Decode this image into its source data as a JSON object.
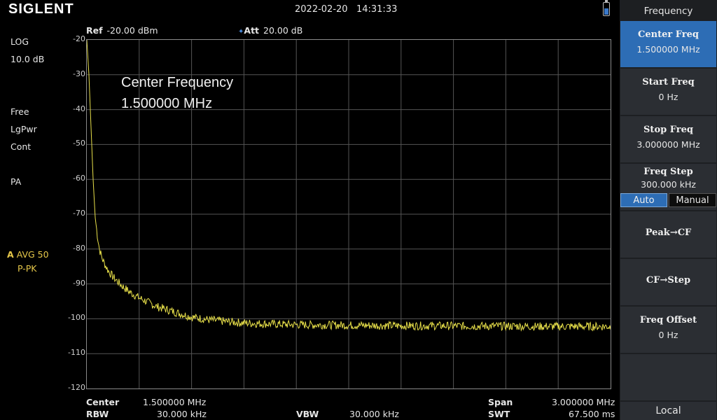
{
  "header": {
    "logo": "SIGLENT",
    "date": "2022-02-20",
    "time": "14:31:33"
  },
  "left_panel": {
    "scale_type": "LOG",
    "scale_div": "10.0 dB",
    "trigger": "Free",
    "detector": "LgPwr",
    "sweep": "Cont",
    "preamp": "PA",
    "trace_label": "A",
    "trace_mode": "AVG 50",
    "trace_detect": "P-PK"
  },
  "top_info": {
    "ref_label": "Ref",
    "ref_value": "-20.00 dBm",
    "att_label": "Att",
    "att_value": "20.00 dB"
  },
  "marker_overlay": {
    "title": "Center Frequency",
    "value": "1.500000 MHz"
  },
  "bottom": {
    "center_label": "Center",
    "center_value": "1.500000 MHz",
    "rbw_label": "RBW",
    "rbw_value": "30.000 kHz",
    "vbw_label": "VBW",
    "vbw_value": "30.000 kHz",
    "span_label": "Span",
    "span_value": "3.000000 MHz",
    "swt_label": "SWT",
    "swt_value": "67.500 ms"
  },
  "sidebar": {
    "title": "Frequency",
    "buttons": [
      {
        "label": "Center Freq",
        "value": "1.500000 MHz"
      },
      {
        "label": "Start Freq",
        "value": "0 Hz"
      },
      {
        "label": "Stop Freq",
        "value": "3.000000 MHz"
      },
      {
        "label": "Freq Step",
        "value": "300.000 kHz"
      },
      {
        "label": "Peak→CF"
      },
      {
        "label": "CF→Step"
      },
      {
        "label": "Freq Offset",
        "value": "0 Hz"
      }
    ],
    "toggle_auto": "Auto",
    "toggle_manual": "Manual",
    "local": "Local"
  },
  "colors": {
    "trace": "#e8e04a",
    "grid": "#555555",
    "active_button": "#2d6db5"
  },
  "chart_data": {
    "type": "line",
    "x_unit": "MHz",
    "y_unit": "dBm",
    "xlim": [
      0,
      3
    ],
    "ylim": [
      -120,
      -20
    ],
    "y_ticks": [
      -20,
      -30,
      -40,
      -50,
      -60,
      -70,
      -80,
      -90,
      -100,
      -110,
      -120
    ],
    "grid": true,
    "series": [
      {
        "x": [
          0,
          0.012,
          0.024,
          0.036,
          0.048,
          0.06,
          0.072,
          0.09,
          0.12,
          0.15,
          0.2,
          0.25,
          0.3,
          0.4,
          0.5,
          0.6,
          0.7,
          0.8,
          0.9,
          1.0,
          1.2,
          1.4,
          1.6,
          1.8,
          2.0,
          2.2,
          2.4,
          2.6,
          2.8,
          3.0
        ],
        "y": [
          -20,
          -30,
          -45,
          -60,
          -71,
          -76,
          -80,
          -83,
          -86,
          -88,
          -90.5,
          -92.5,
          -94,
          -96.5,
          -98,
          -99.5,
          -100.3,
          -100.8,
          -101.2,
          -101.4,
          -101.7,
          -101.8,
          -101.9,
          -102,
          -102,
          -102.1,
          -102.1,
          -102.2,
          -102.2,
          -102.2
        ]
      }
    ]
  }
}
